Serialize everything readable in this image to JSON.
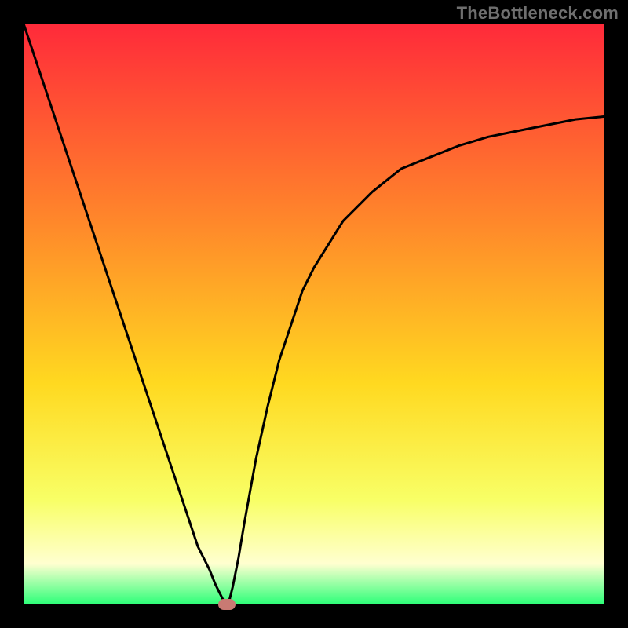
{
  "watermark": "TheBottleneck.com",
  "colors": {
    "background": "#000000",
    "gradient_top": "#ff2a3a",
    "gradient_upper_mid": "#ff8a2a",
    "gradient_mid": "#ffd920",
    "gradient_lower_mid": "#f8ff66",
    "gradient_pale": "#ffffd0",
    "gradient_bottom": "#2cff78",
    "curve": "#000000",
    "marker": "#c97a73"
  },
  "chart_data": {
    "type": "line",
    "title": "",
    "xlabel": "",
    "ylabel": "",
    "x": [
      0.0,
      0.02,
      0.04,
      0.06,
      0.08,
      0.1,
      0.12,
      0.14,
      0.16,
      0.18,
      0.2,
      0.22,
      0.24,
      0.26,
      0.28,
      0.3,
      0.32,
      0.33,
      0.34,
      0.345,
      0.35,
      0.355,
      0.36,
      0.37,
      0.38,
      0.4,
      0.42,
      0.44,
      0.46,
      0.48,
      0.5,
      0.55,
      0.6,
      0.65,
      0.7,
      0.75,
      0.8,
      0.85,
      0.9,
      0.95,
      1.0
    ],
    "y": [
      1.0,
      0.94,
      0.88,
      0.82,
      0.76,
      0.7,
      0.64,
      0.58,
      0.52,
      0.46,
      0.4,
      0.34,
      0.28,
      0.22,
      0.16,
      0.1,
      0.06,
      0.035,
      0.015,
      0.005,
      0.0,
      0.01,
      0.03,
      0.08,
      0.14,
      0.25,
      0.34,
      0.42,
      0.48,
      0.54,
      0.58,
      0.66,
      0.71,
      0.75,
      0.77,
      0.79,
      0.805,
      0.815,
      0.825,
      0.835,
      0.84
    ],
    "xlim": [
      0,
      1
    ],
    "ylim": [
      0,
      1
    ],
    "marker": {
      "x": 0.35,
      "y": 0.0
    },
    "grid": false,
    "legend": false
  }
}
